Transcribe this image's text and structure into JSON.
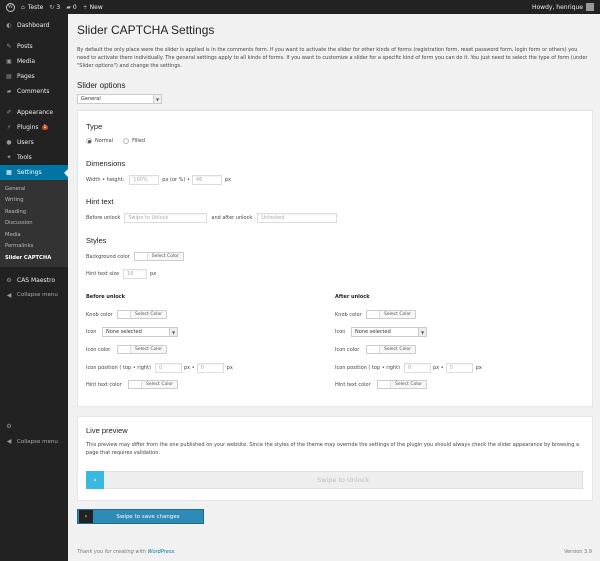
{
  "adminbar": {
    "site_name": "Teste",
    "updates_count": "3",
    "comments_count": "0",
    "new_label": "New",
    "howdy": "Howdy, henrique"
  },
  "sidebar": {
    "items": [
      {
        "label": "Dashboard",
        "icon": "dashboard-icon",
        "glyph": "◐"
      },
      {
        "label": "Posts",
        "icon": "pin-icon",
        "glyph": "✎"
      },
      {
        "label": "Media",
        "icon": "media-icon",
        "glyph": "▣"
      },
      {
        "label": "Pages",
        "icon": "pages-icon",
        "glyph": "▤"
      },
      {
        "label": "Comments",
        "icon": "comment-icon",
        "glyph": "▰"
      },
      {
        "label": "Appearance",
        "icon": "brush-icon",
        "glyph": "✐"
      },
      {
        "label": "Plugins",
        "icon": "plugin-icon",
        "glyph": "⚡",
        "badge": "1"
      },
      {
        "label": "Users",
        "icon": "user-icon",
        "glyph": "●"
      },
      {
        "label": "Tools",
        "icon": "wrench-icon",
        "glyph": "✦"
      },
      {
        "label": "Settings",
        "icon": "settings-icon",
        "glyph": "▦"
      }
    ],
    "submenu": [
      "General",
      "Writing",
      "Reading",
      "Discussion",
      "Media",
      "Permalinks",
      "Slider CAPTCHA"
    ],
    "cas_maestro": "CAS Maestro",
    "collapse": "Collapse menu",
    "collapse_bottom": "Collapse menu"
  },
  "page": {
    "title": "Slider CAPTCHA Settings",
    "intro": "By default the only place were the slider is applied is in the comments form. If you want to activate the slider for other kinds of forms (registration form, reset password form, login form or others) you need to activate them individually. The general settings apply to all kinds of forms. If you want to customize a slider for a specific kind of form you can do it. You just need to select the type of form (under \"Slider options\") and change the settings.",
    "slider_options_heading": "Slider options",
    "form_select": "General"
  },
  "settings": {
    "type_heading": "Type",
    "type_normal": "Normal",
    "type_filled": "Filled",
    "dimensions_heading": "Dimensions",
    "width_height_label": "Width • height:",
    "width_placeholder": "100%",
    "width_unit": "px (or %) •",
    "height_placeholder": "46",
    "height_unit": "px",
    "hint_heading": "Hint text",
    "before_unlock_label": "Before unlock",
    "before_unlock_placeholder": "Swipe to Unlock",
    "after_unlock_label": "and after unlock",
    "after_unlock_placeholder": "Unlocked",
    "styles_heading": "Styles",
    "background_color_label": "Background color",
    "select_color": "Select Color",
    "hint_size_label": "Hint text size",
    "hint_size_placeholder": "16",
    "px": "px",
    "before": {
      "heading": "Before unlock",
      "knob_color": "Knob color",
      "icon_label": "Icon",
      "icon_select": "None selected",
      "icon_color": "Icon color",
      "icon_position": "Icon position ( top • right)",
      "pos_top": "0",
      "pos_sep": "px •",
      "pos_right": "0",
      "pos_unit": "px",
      "hint_color": "Hint text color"
    },
    "after": {
      "heading": "After unlock",
      "knob_color": "Knob color",
      "icon_label": "Icon",
      "icon_select": "None selected",
      "icon_color": "Icon color",
      "icon_position": "Icon position ( top • right)",
      "pos_top": "0",
      "pos_sep": "px •",
      "pos_right": "0",
      "pos_unit": "px",
      "hint_color": "Hint text color"
    }
  },
  "preview": {
    "heading": "Live preview",
    "text": "This preview may differ from the one published on your website. Since the styles of the theme may override the settings of the plugin you should always check the slider appearance by browsing a page that requires validation.",
    "knob_glyph": "›",
    "slider_text": "Swipe to Unlock"
  },
  "save": {
    "chevron": "›",
    "label": "Swipe to save changes"
  },
  "footer": {
    "thanks_prefix": "Thank you for creating with ",
    "wordpress_link": "WordPress",
    "thanks_suffix": ".",
    "version": "Version 3.9"
  },
  "colors": {
    "accent": "#0074a2",
    "admin_dark": "#222222",
    "slider_knob": "#3bb8e0",
    "save_button": "#2e8bb8",
    "update_badge": "#d54e21"
  }
}
